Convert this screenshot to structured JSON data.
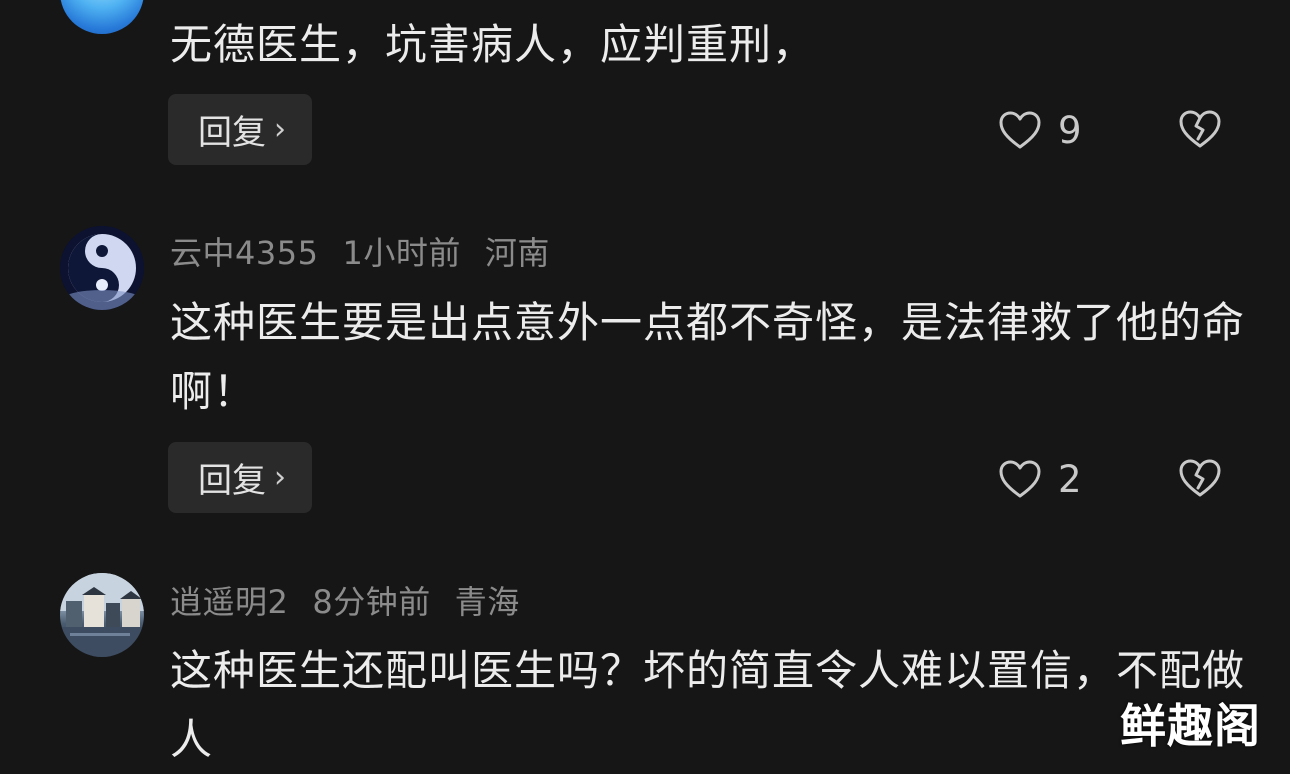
{
  "comments": [
    {
      "text": "无德医生，坑害病人，应判重刑，",
      "reply_label": "回复",
      "likes": "9"
    },
    {
      "username": "云中4355",
      "time": "1小时前",
      "location": "河南",
      "text": "这种医生要是出点意外一点都不奇怪，是法律救了他的命啊！",
      "reply_label": "回复",
      "likes": "2"
    },
    {
      "username": "逍遥明2",
      "time": "8分钟前",
      "location": "青海",
      "text": "这种医生还配叫医生吗？坏的简直令人难以置信，不配做人"
    }
  ],
  "icons": {
    "like": "heart-outline-icon",
    "dislike": "broken-heart-icon",
    "reply_arrow": "chevron-right-icon"
  },
  "watermark": "鲜趣阁",
  "colors": {
    "background": "#161616",
    "text": "#ececec",
    "meta": "#8b8b8b",
    "button": "#2a2a2a"
  }
}
